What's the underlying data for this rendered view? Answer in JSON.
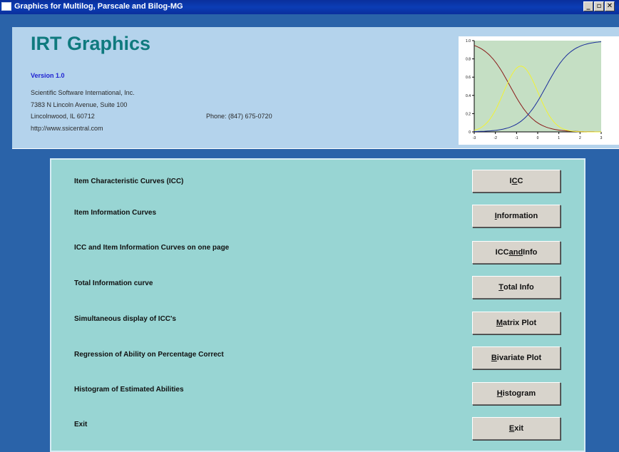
{
  "window": {
    "title": "Graphics for Multilog, Parscale and Bilog-MG",
    "controls": [
      "_",
      "▫",
      "✕"
    ]
  },
  "header": {
    "app_title": "IRT Graphics",
    "version": "Version 1.0",
    "company": "Scientific Software International, Inc.",
    "address1": "7383 N Lincoln Avenue, Suite 100",
    "address2": "Lincolnwood, IL 60712",
    "phone": "Phone: (847) 675-0720",
    "website": "http://www.ssicentral.com"
  },
  "thumbnail": {
    "y_ticks": [
      "1.0",
      "0.8",
      "0.6",
      "0.4",
      "0.2",
      "0"
    ],
    "x_ticks": [
      "-3",
      "-2",
      "-1",
      "0",
      "1",
      "2",
      "3"
    ],
    "colors": {
      "background": "#c5dfc4",
      "decreasing": "#8a1a1a",
      "info": "#f2f235",
      "increasing": "#1a2c9a"
    }
  },
  "rows": [
    {
      "label": "Item Characteristic Curves (ICC)",
      "btn_pre": "I",
      "btn_key": "C",
      "btn_post": "C"
    },
    {
      "label": "Item Information Curves",
      "btn_pre": "",
      "btn_key": "I",
      "btn_post": "nformation"
    },
    {
      "label": "ICC and Item Information Curves on one page",
      "btn_pre": "ICC ",
      "btn_key": "and",
      "btn_post": " Info"
    },
    {
      "label": "Total Information curve",
      "btn_pre": "",
      "btn_key": "T",
      "btn_post": "otal Info"
    },
    {
      "label": "Simultaneous display of ICC's",
      "btn_pre": "",
      "btn_key": "M",
      "btn_post": "atrix Plot"
    },
    {
      "label": "Regression of Ability on Percentage Correct",
      "btn_pre": "",
      "btn_key": "B",
      "btn_post": "ivariate Plot"
    },
    {
      "label": "Histogram of Estimated Abilities",
      "btn_pre": "",
      "btn_key": "H",
      "btn_post": "istogram"
    },
    {
      "label": "Exit",
      "btn_pre": "",
      "btn_key": "E",
      "btn_post": "xit"
    }
  ]
}
